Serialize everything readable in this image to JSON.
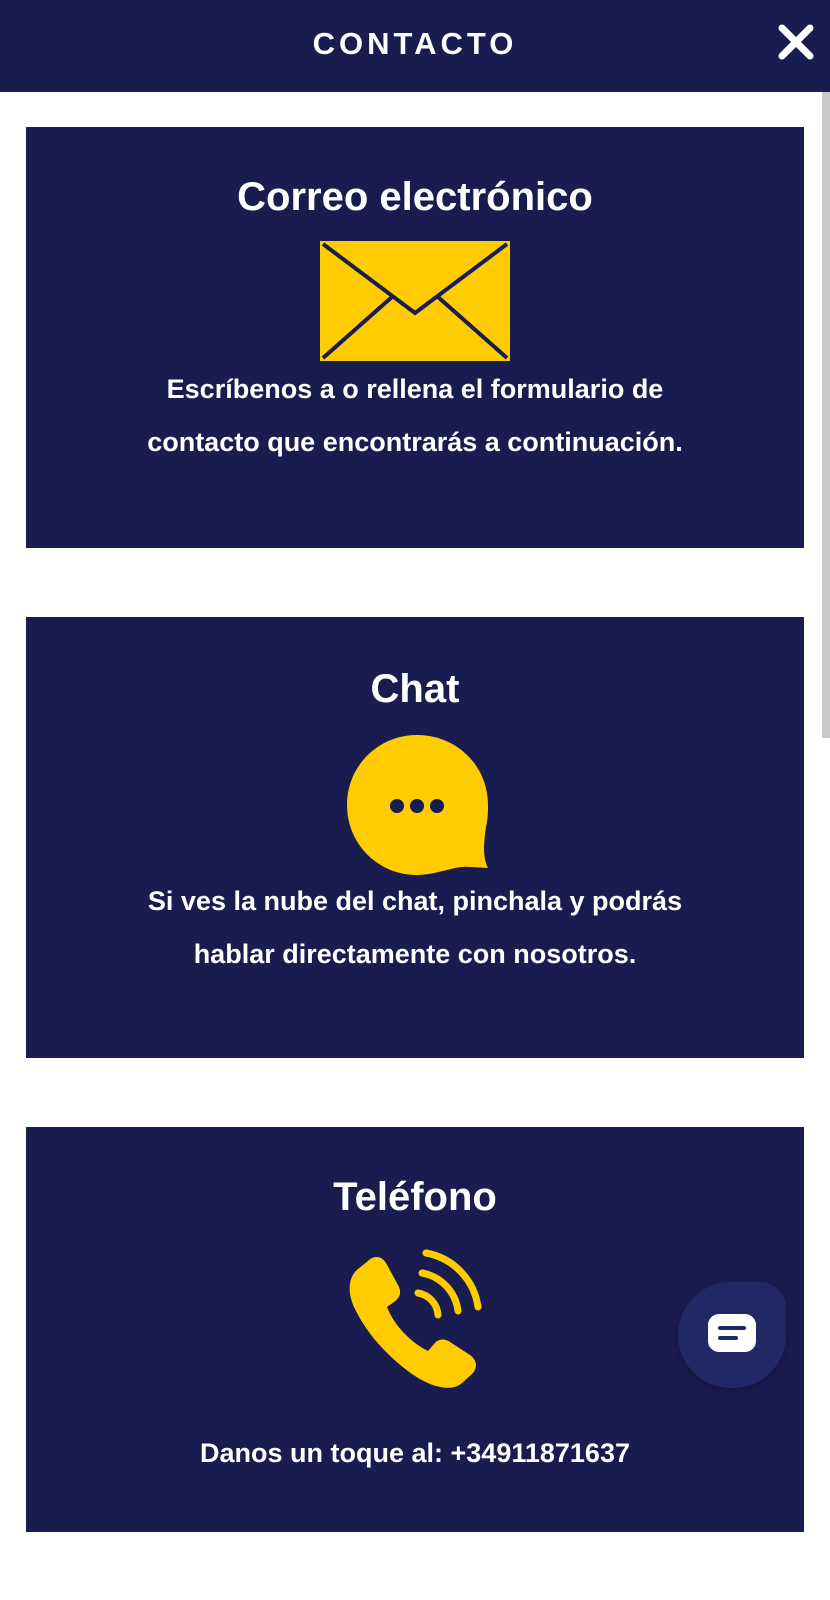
{
  "header": {
    "title": "CONTACTO",
    "close_icon": "close-icon"
  },
  "colors": {
    "navy": "#191c4e",
    "accent_yellow": "#ffcc00",
    "white": "#ffffff",
    "fab": "#202866"
  },
  "cards": [
    {
      "title": "Correo electrónico",
      "icon": "envelope-icon",
      "text_lines": [
        "Escríbenos a o rellena el formulario de",
        "contacto que encontrarás a continuación."
      ]
    },
    {
      "title": "Chat",
      "icon": "chat-bubble-icon",
      "text_lines": [
        "Si ves la nube del chat, pinchala y podrás",
        "hablar directamente con nosotros."
      ]
    },
    {
      "title": "Teléfono",
      "icon": "phone-icon",
      "text_lines": [
        "Danos un toque al: +34911871637"
      ]
    }
  ],
  "chat_widget": {
    "icon": "chat-widget-icon"
  }
}
